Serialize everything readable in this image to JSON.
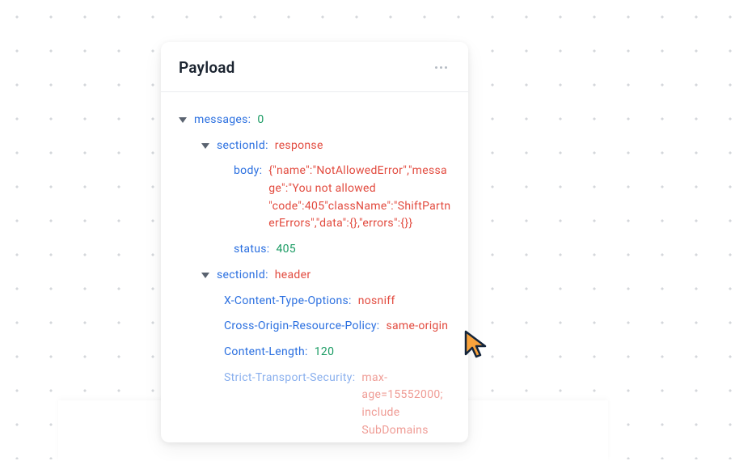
{
  "card": {
    "title": "Payload"
  },
  "tree": {
    "messages_key": "messages:",
    "messages_val": "0",
    "section1": {
      "key": "sectionId:",
      "val": "response",
      "body_key": "body:",
      "body_val": "{\"name\":\"NotAllowedError\",\"message\":\"You not allowed \"code\":405\"className\":\"ShiftPartnerErrors\",\"data\":{},\"errors\":{}}",
      "status_key": "status:",
      "status_val": "405"
    },
    "section2": {
      "key": "sectionId:",
      "val": "header",
      "xcto_key": "X-Content-Type-Options:",
      "xcto_val": "nosniff",
      "corp_key": "Cross-Origin-Resource-Policy:",
      "corp_val": "same-origin",
      "cl_key": "Content-Length:",
      "cl_val": "120",
      "sts_key": "Strict-Transport-Security:",
      "sts_val": "max-age=15552000; include SubDomains"
    }
  }
}
